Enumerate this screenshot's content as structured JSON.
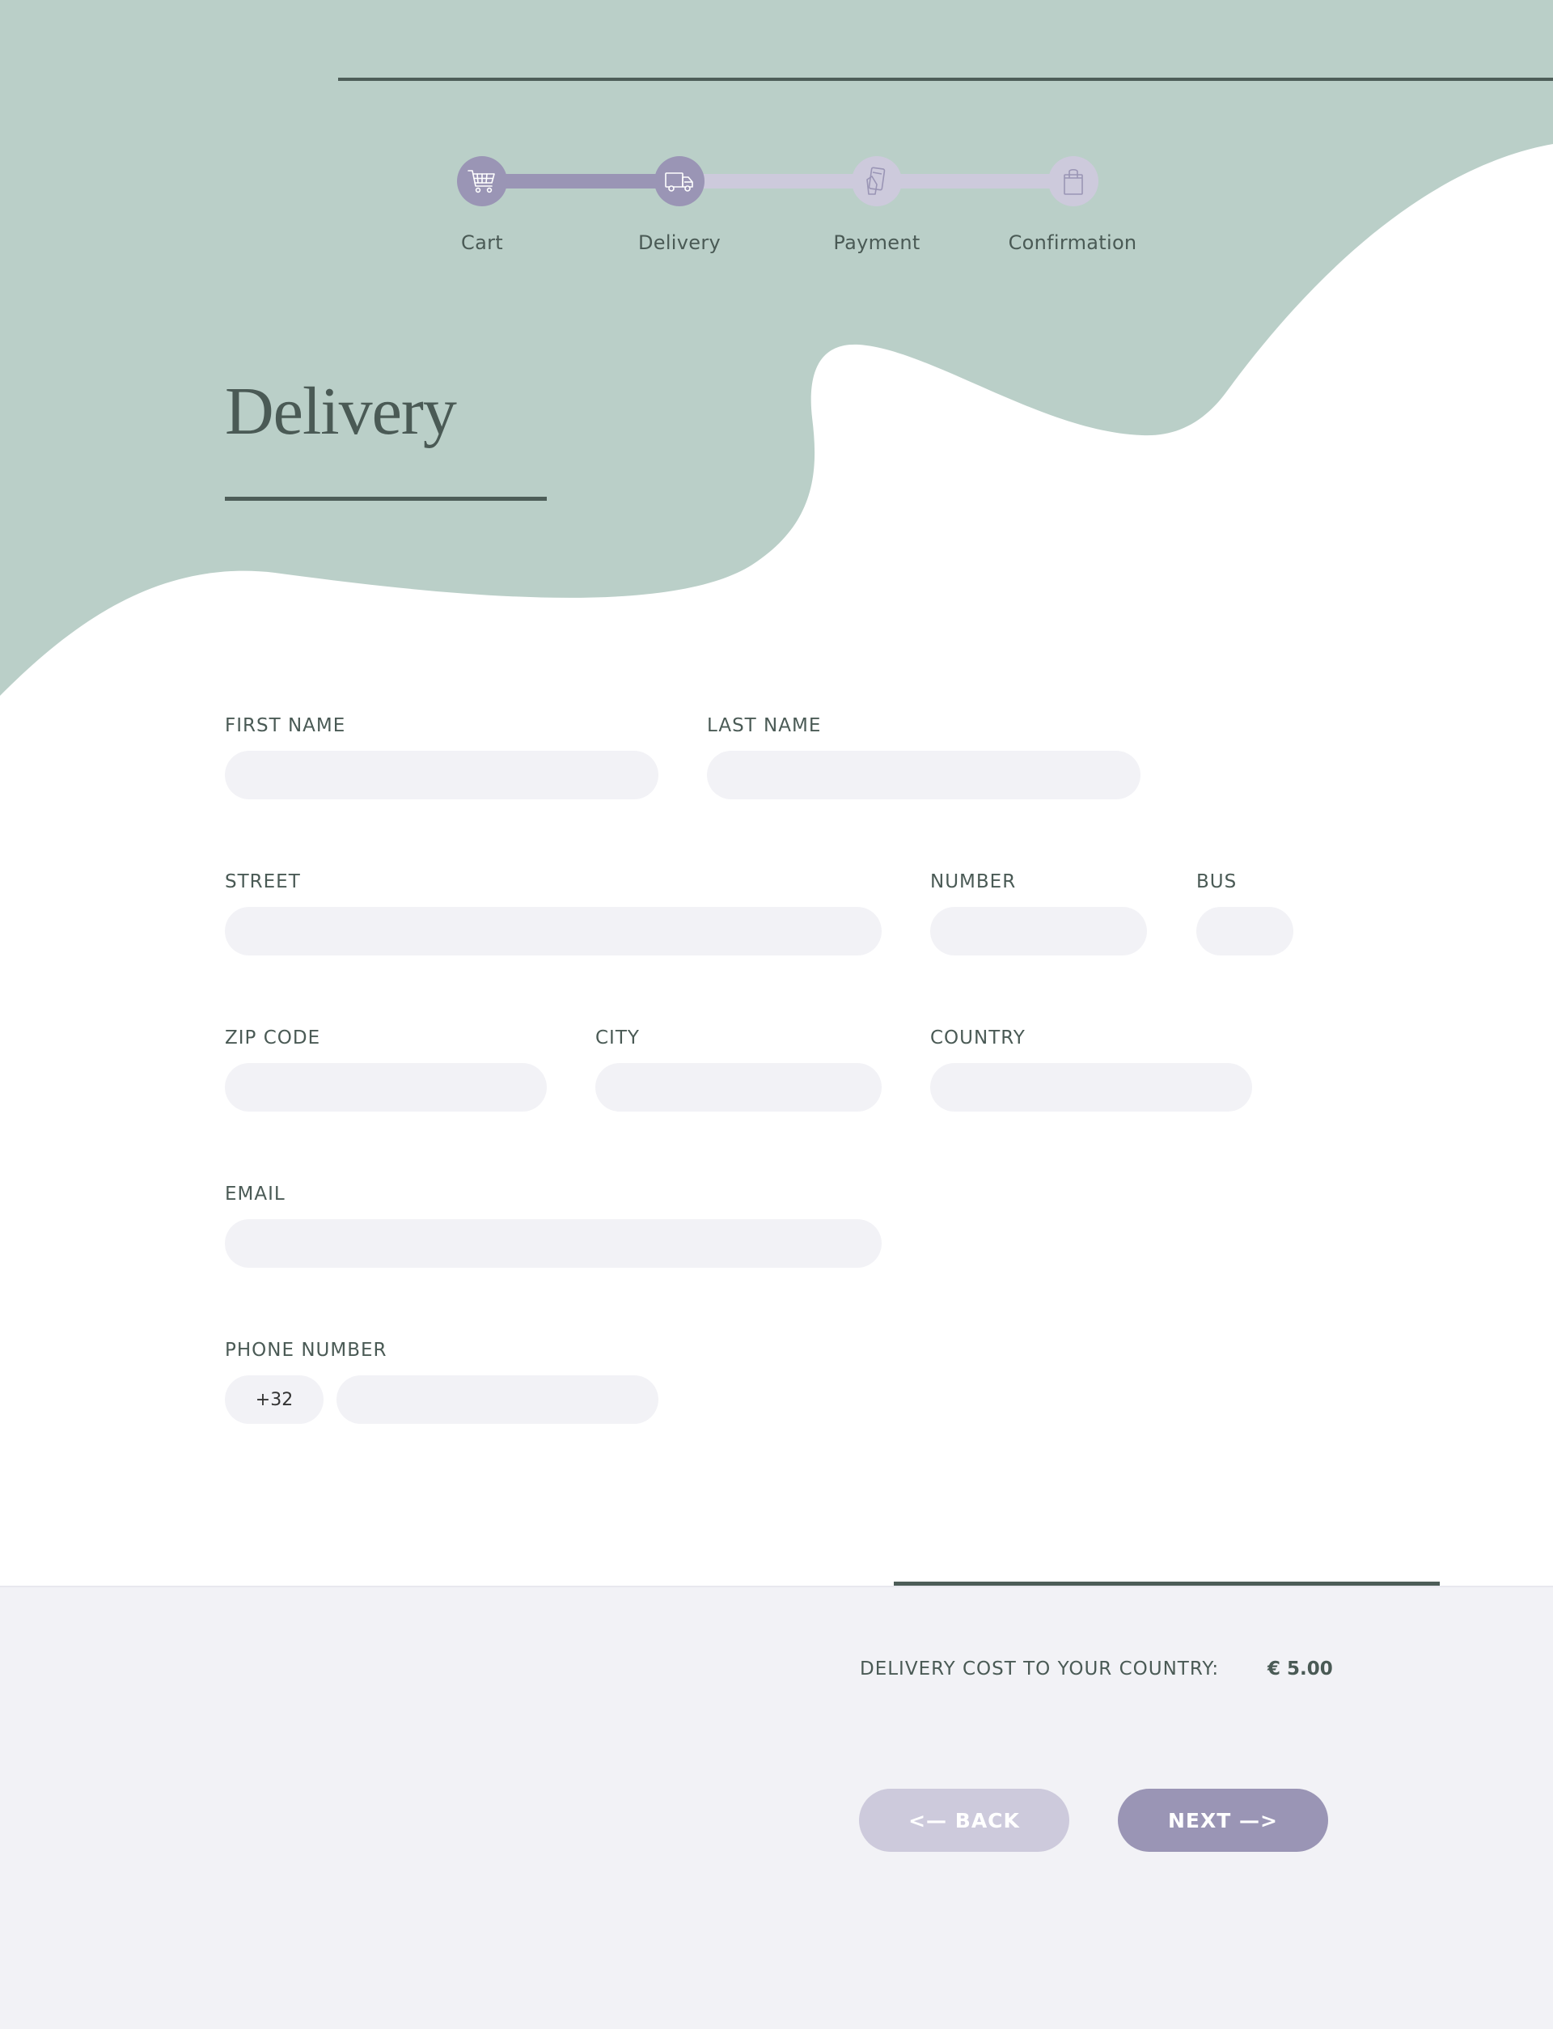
{
  "colors": {
    "header_bg": "#bacfc8",
    "accent": "#9a95b5",
    "accent_light": "#cdcadc",
    "text": "#4a5a55",
    "input_bg": "#f2f2f6",
    "rule": "#4d5d58"
  },
  "stepper": {
    "current_step": 2,
    "steps": [
      {
        "label": "Cart",
        "icon": "shopping-cart-icon",
        "state": "done"
      },
      {
        "label": "Delivery",
        "icon": "delivery-truck-icon",
        "state": "done"
      },
      {
        "label": "Payment",
        "icon": "credit-card-icon",
        "state": "todo"
      },
      {
        "label": "Confirmation",
        "icon": "shopping-bag-icon",
        "state": "todo"
      }
    ]
  },
  "page": {
    "title": "Delivery"
  },
  "form": {
    "first_name": {
      "label": "FIRST NAME",
      "value": ""
    },
    "last_name": {
      "label": "LAST NAME",
      "value": ""
    },
    "street": {
      "label": "STREET",
      "value": ""
    },
    "number": {
      "label": "NUMBER",
      "value": ""
    },
    "bus": {
      "label": "BUS",
      "value": ""
    },
    "zip_code": {
      "label": "ZIP CODE",
      "value": ""
    },
    "city": {
      "label": "CITY",
      "value": ""
    },
    "country": {
      "label": "COUNTRY",
      "value": ""
    },
    "email": {
      "label": "EMAIL",
      "value": ""
    },
    "phone": {
      "label": "PHONE NUMBER",
      "prefix": "+32",
      "value": ""
    }
  },
  "footer": {
    "cost_label": "DELIVERY COST TO YOUR COUNTRY:",
    "cost_value": "€ 5.00",
    "back_label": "<— BACK",
    "next_label": "NEXT —>"
  }
}
